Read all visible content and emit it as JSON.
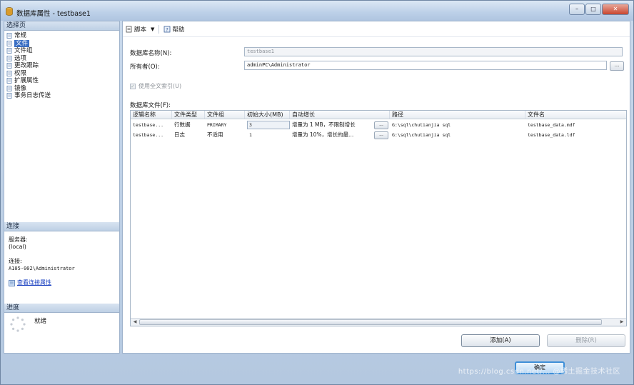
{
  "window": {
    "title": "数据库属性 - testbase1",
    "controls": {
      "minimize": "–",
      "maximize": "□",
      "close": "✕"
    }
  },
  "left_pane": {
    "header": "选择页",
    "items": [
      {
        "label": "常规",
        "selected": false
      },
      {
        "label": "文件",
        "selected": true
      },
      {
        "label": "文件组",
        "selected": false
      },
      {
        "label": "选项",
        "selected": false
      },
      {
        "label": "更改跟踪",
        "selected": false
      },
      {
        "label": "权限",
        "selected": false
      },
      {
        "label": "扩展属性",
        "selected": false
      },
      {
        "label": "镜像",
        "selected": false
      },
      {
        "label": "事务日志传送",
        "selected": false
      }
    ],
    "connection": {
      "header": "连接",
      "server_label": "服务器:",
      "server_value": "(local)",
      "conn_label": "连接:",
      "conn_value": "A105-002\\Administrator",
      "link_text": "查看连接属性"
    },
    "progress": {
      "header": "进度",
      "status": "就绪"
    }
  },
  "toolbar": {
    "script_label": "脚本",
    "help_label": "帮助"
  },
  "form": {
    "db_name_label": "数据库名称(N):",
    "db_name_value": "testbase1",
    "owner_label": "所有者(O):",
    "owner_value": "adminPC\\Administrator",
    "owner_button": "...",
    "fulltext_label": "使用全文索引(U)",
    "files_label": "数据库文件(F):"
  },
  "grid": {
    "columns": [
      "逻辑名称",
      "文件类型",
      "文件组",
      "初始大小(MB)",
      "自动增长",
      "路径",
      "文件名"
    ],
    "rows": [
      {
        "name": "testbase...",
        "type": "行数据",
        "group": "PRIMARY",
        "size": "3",
        "growth": "增量为 1 MB，不限制增长",
        "growth_btn": "...",
        "path": "G:\\sql\\chutianjia sql",
        "filename": "testbase_data.mdf"
      },
      {
        "name": "testbase...",
        "type": "日志",
        "group": "不适用",
        "size": "1",
        "growth": "增量为 10%，增长的最...",
        "growth_btn": "...",
        "path": "G:\\sql\\chutianjia sql",
        "filename": "testbase_data.ldf"
      }
    ]
  },
  "buttons": {
    "add": "添加(A)",
    "remove": "删除(R)",
    "ok": "确定"
  },
  "watermark": "https://blog.csdn.net/... @稀土掘金技术社区",
  "colors": {
    "selection": "#3a6fc4",
    "link": "#1a40c0",
    "frame": "#b4c8e0"
  }
}
